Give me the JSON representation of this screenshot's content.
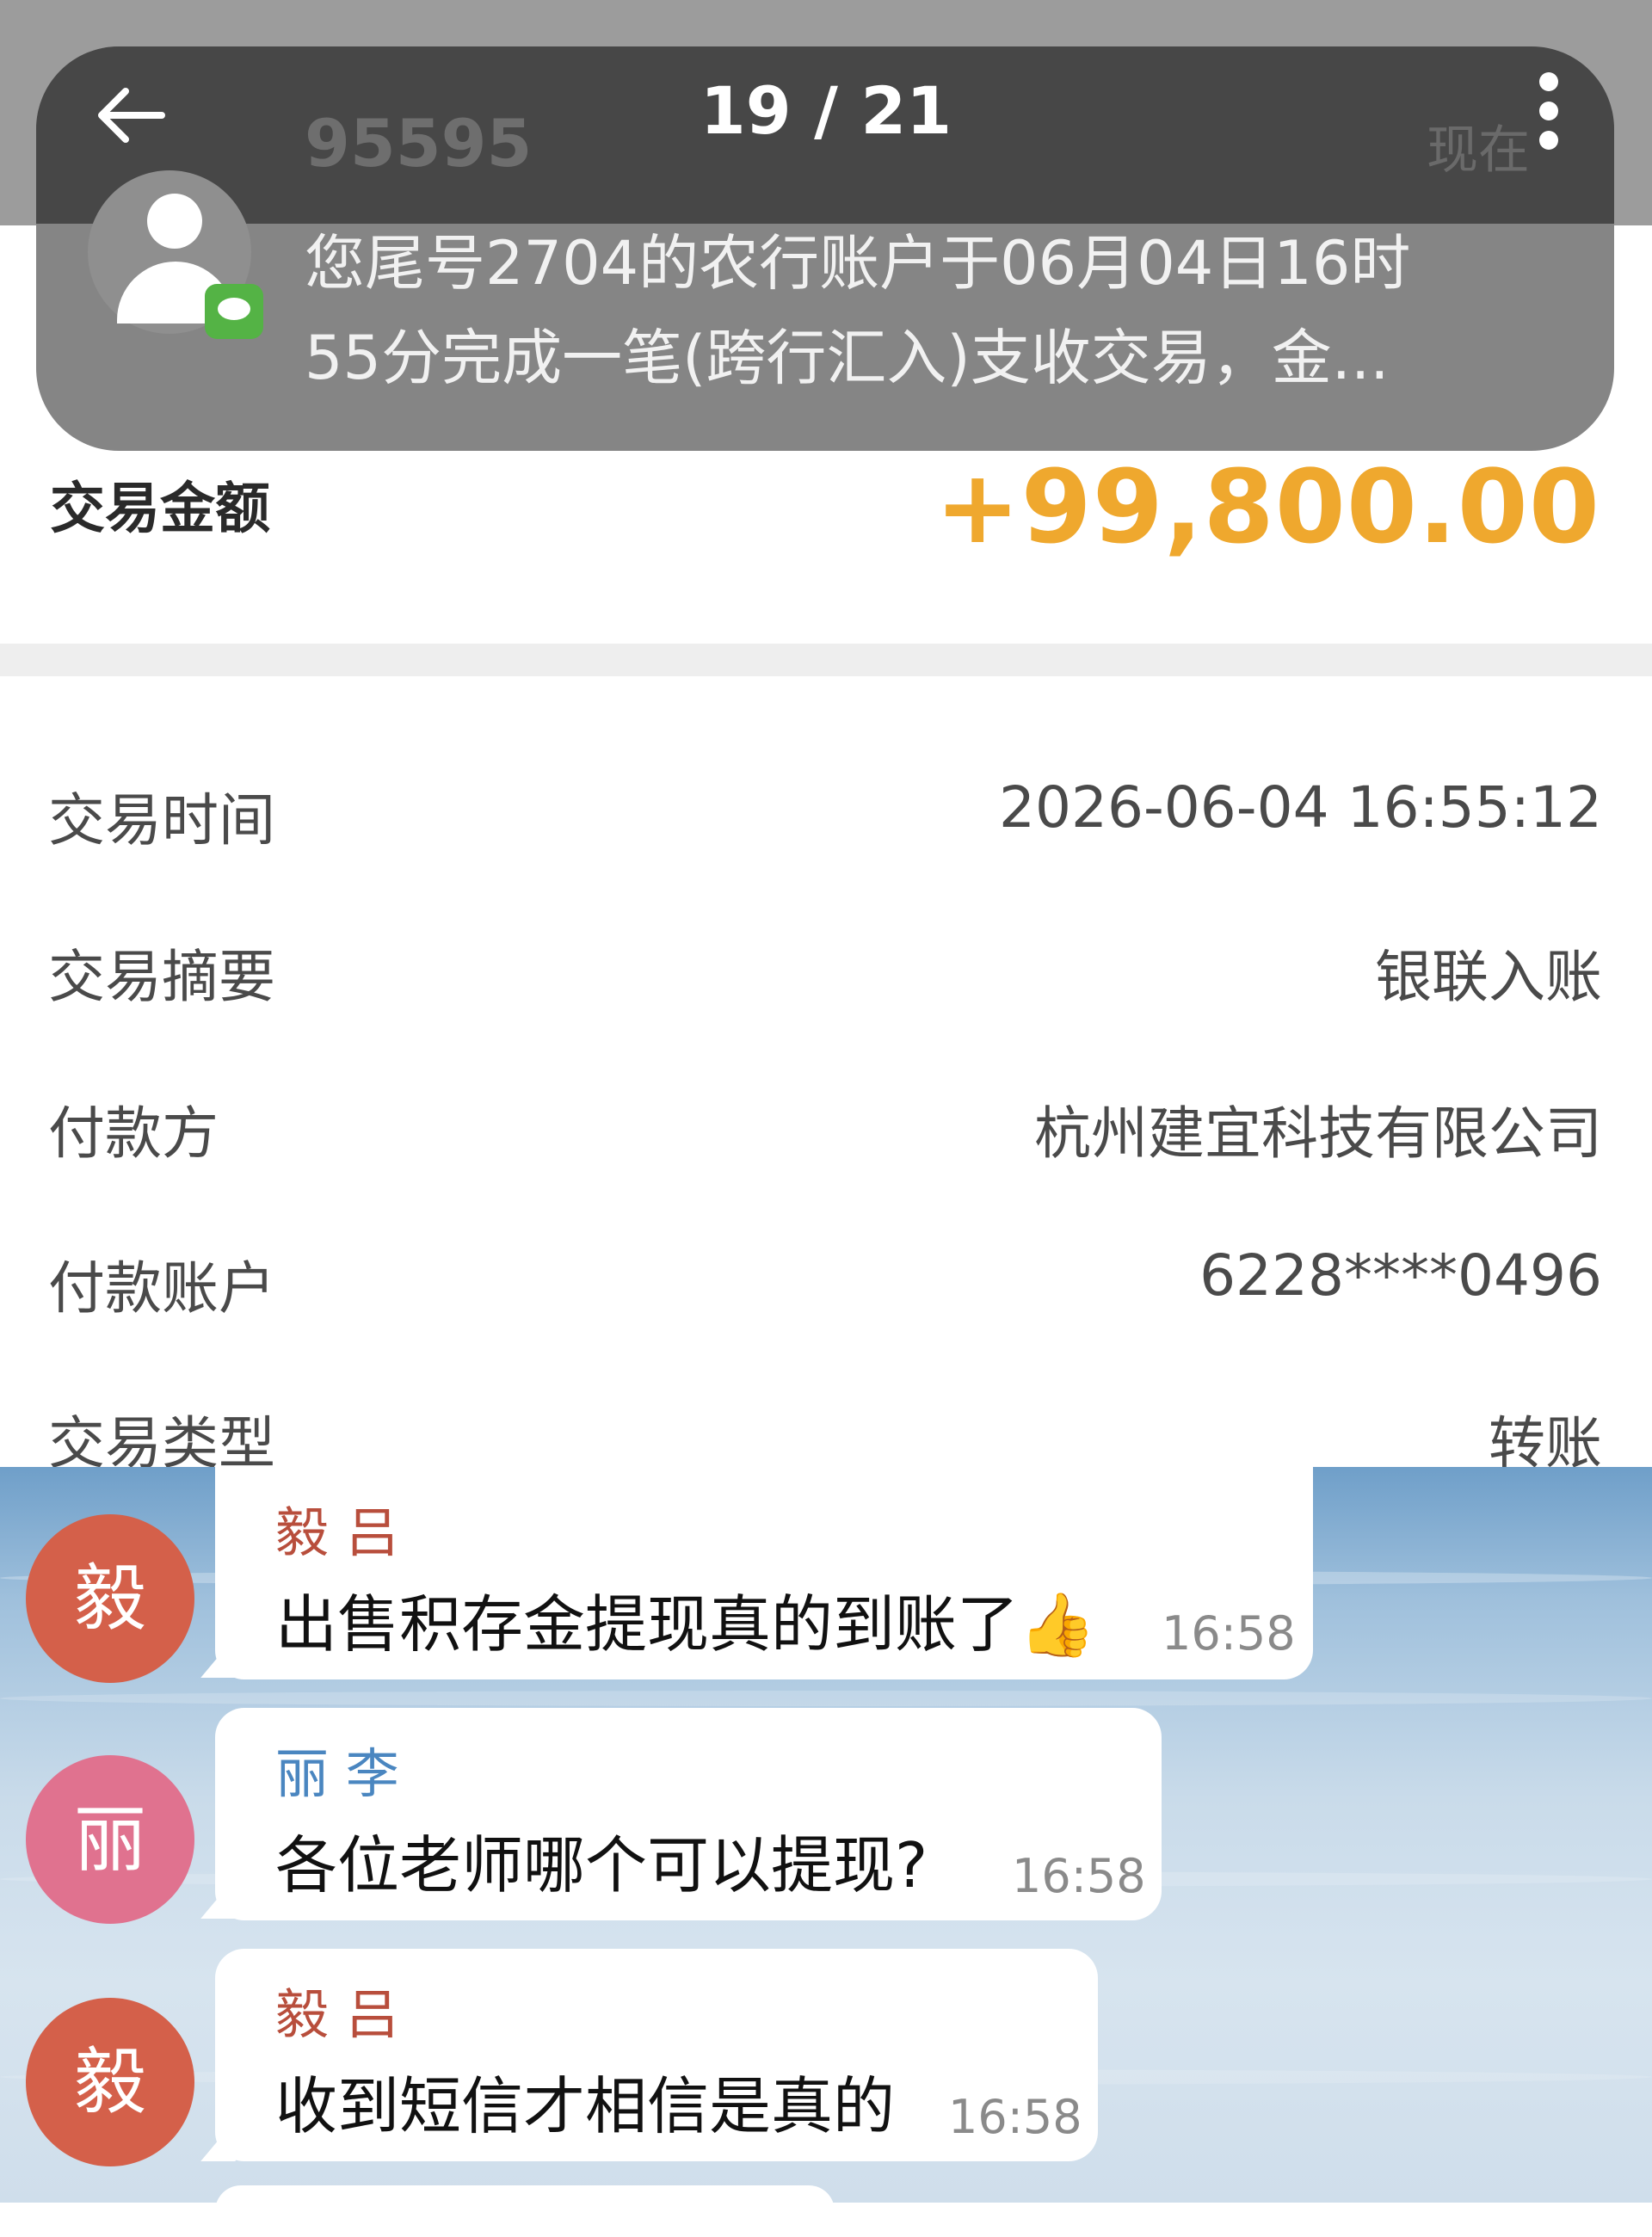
{
  "viewer": {
    "counter": "19 / 21"
  },
  "notification": {
    "sender": "95595",
    "time": "现在",
    "line1": "您尾号2704的农行账户于06月04日16时",
    "line2": "55分完成一笔(跨行汇入)支收交易，金..."
  },
  "receipt": {
    "amount_label": "交易金额",
    "amount_value": "+99,800.00",
    "rows": [
      {
        "label": "交易时间",
        "value": "2026-06-04 16:55:12"
      },
      {
        "label": "交易摘要",
        "value": "银联入账"
      },
      {
        "label": "付款方",
        "value": "杭州建宜科技有限公司"
      },
      {
        "label": "付款账户",
        "value": "6228****0496"
      },
      {
        "label": "交易类型",
        "value": "转账"
      }
    ]
  },
  "chat": {
    "messages": [
      {
        "avatar": "毅",
        "name": "毅 吕",
        "text": "出售积存金提现真的到账了",
        "emoji": "👍",
        "time": "16:58",
        "avatar_color": "#d4604a",
        "name_color": "#b84e3c"
      },
      {
        "avatar": "丽",
        "name": "丽 李",
        "text": "各位老师哪个可以提现?",
        "time": "16:58",
        "avatar_color": "#e0728f",
        "name_color": "#4a86c0"
      },
      {
        "avatar": "毅",
        "name": "毅 吕",
        "text": "收到短信才相信是真的",
        "time": "16:58",
        "avatar_color": "#d4604a",
        "name_color": "#b84e3c"
      }
    ]
  }
}
